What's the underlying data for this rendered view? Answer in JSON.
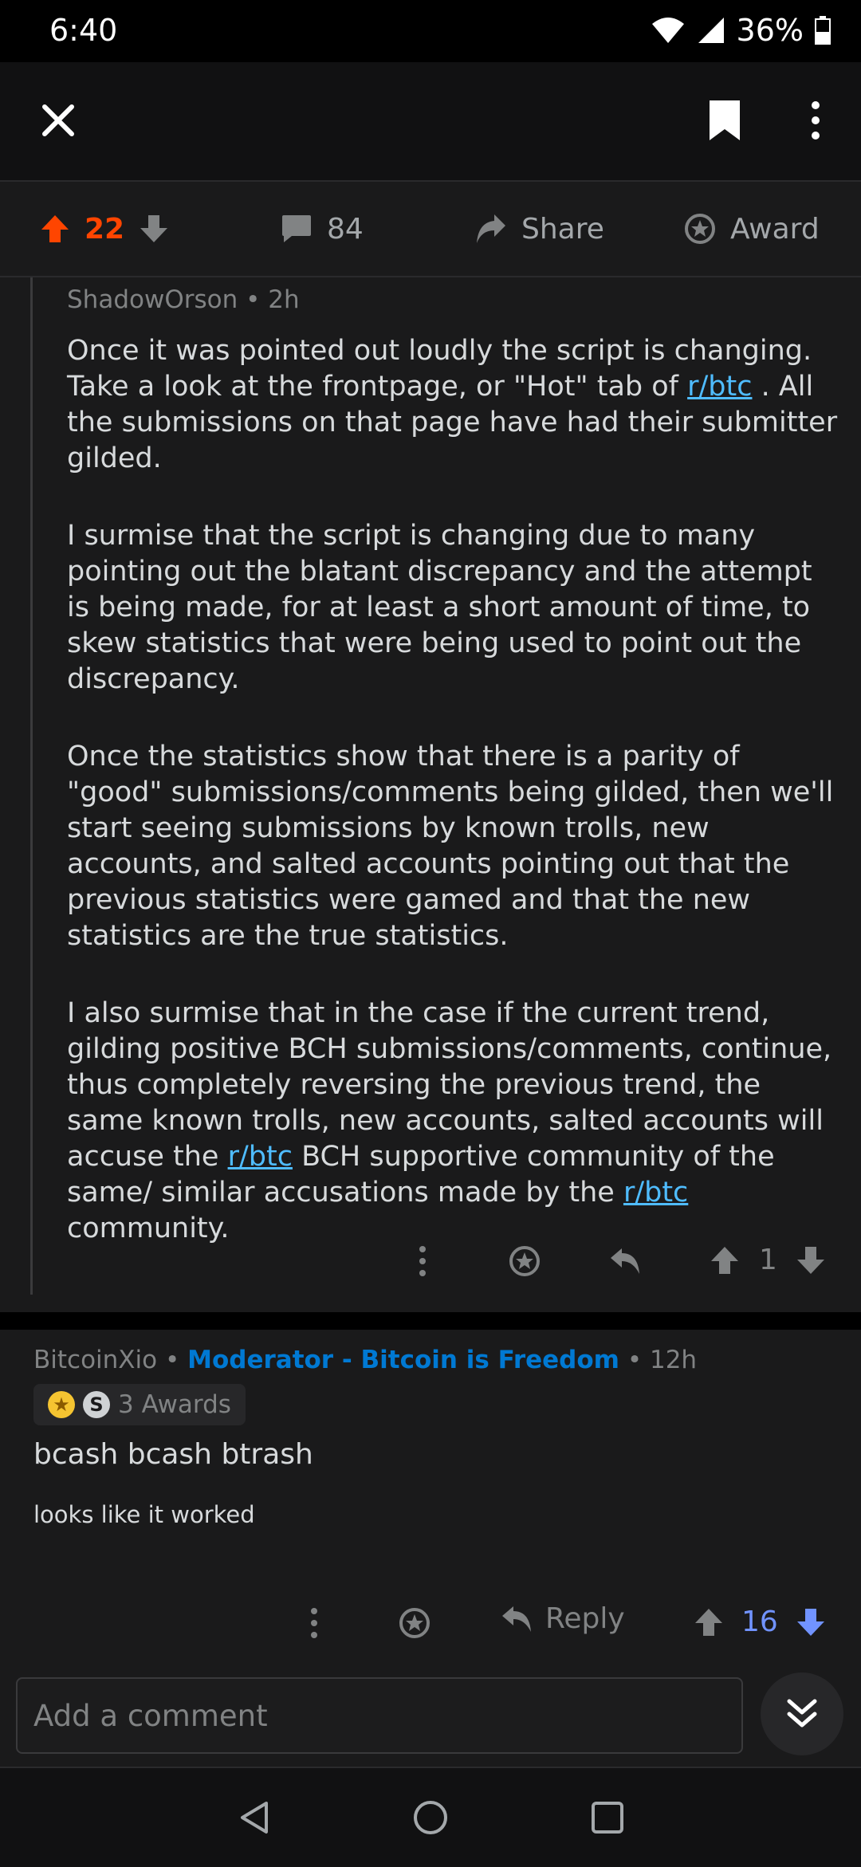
{
  "status": {
    "time": "6:40",
    "battery": "36%"
  },
  "action_bar": {
    "score": "22",
    "comments": "84",
    "share_label": "Share",
    "award_label": "Award"
  },
  "comment1": {
    "author": "ShadowOrson",
    "age": "2h",
    "p1_a": "Once it was pointed out loudly the script is changing. Take a look at the frontpage, or \"Hot\" tab of ",
    "p1_link": "r/btc",
    "p1_b": " . All the submissions on that page have had their submitter gilded.",
    "p2": "I surmise that the script is changing due to many pointing out the blatant discrepancy and the attempt is being made, for at least a short amount of time, to skew statistics that were being used to point out the discrepancy.",
    "p3": "Once the statistics show that there is a parity of \"good\" submissions/comments being gilded, then we'll start seeing submissions by known trolls, new accounts, and salted accounts pointing out that the previous statistics were gamed and that the new statistics are the true statistics.",
    "p4_a": "I also surmise that in the case if the current trend, gilding positive BCH submissions/comments, continue, thus completely reversing the previous trend, the same known trolls, new accounts, salted accounts will accuse the ",
    "p4_link1": "r/btc",
    "p4_b": " BCH supportive community of the same/ similar accusations made by the ",
    "p4_link2": "r/btc",
    "p4_c": " community.",
    "score": "1"
  },
  "comment2": {
    "author": "BitcoinXio",
    "flair": "Moderator - Bitcoin is Freedom",
    "age": "12h",
    "awards_label": "3 Awards",
    "heading": "bcash bcash btrash",
    "body": "looks like it worked",
    "reply_label": "Reply",
    "score": "16"
  },
  "comment_input": {
    "placeholder": "Add a comment"
  },
  "colors": {
    "accent_upvote": "#ff4500",
    "link": "#4fbcff",
    "moderator": "#0079d3",
    "voted_down": "#7193ff"
  }
}
